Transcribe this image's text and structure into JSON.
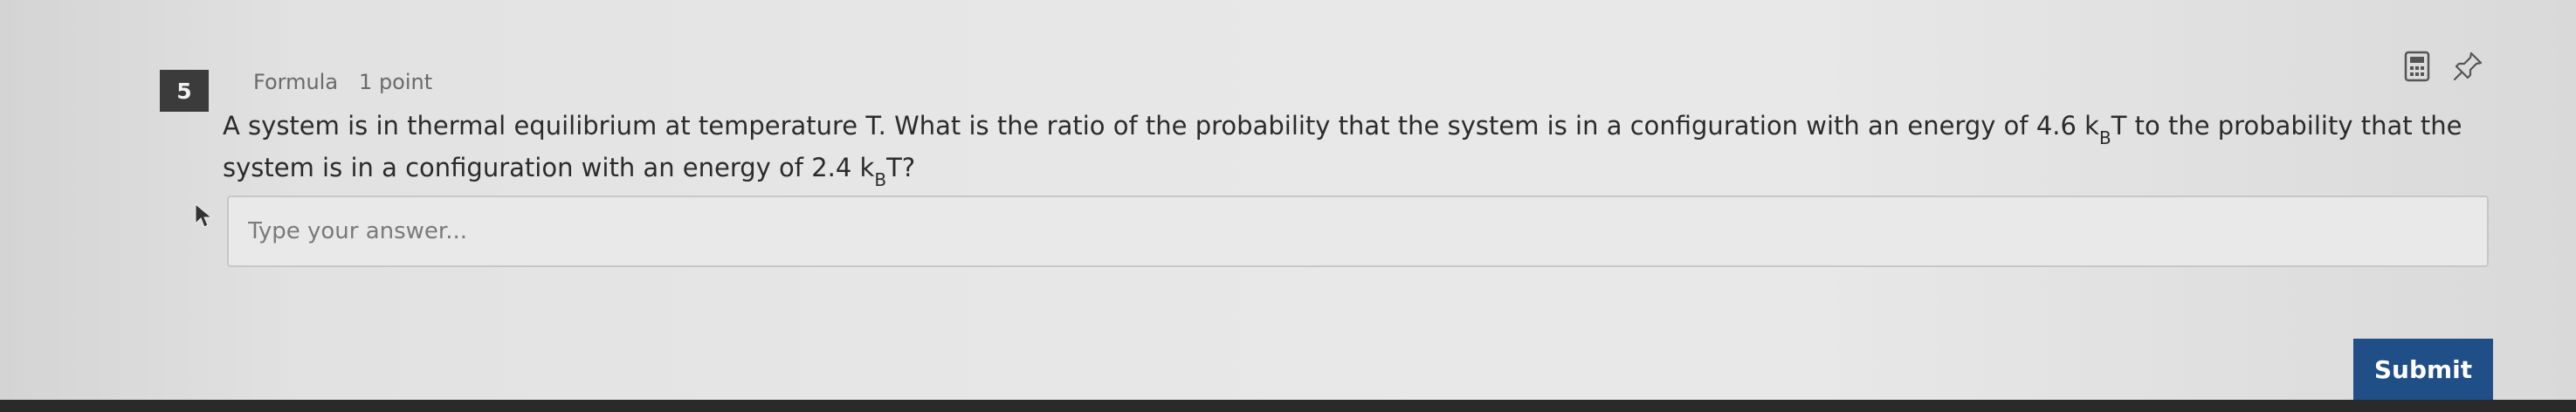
{
  "question": {
    "number": "5",
    "type_label": "Formula",
    "points_label": "1 point",
    "text_part1": "A system is in thermal equilibrium at temperature T. What is the ratio of the probability that the system is in a configuration with an energy of 4.6 k",
    "sub1": "B",
    "text_part2": "T to the probability that the system is in a configuration with an energy of 2.4 k",
    "sub2": "B",
    "text_part3": "T?"
  },
  "answer": {
    "placeholder": "Type your answer..."
  },
  "toolbar": {
    "calculator_icon": "calculator-icon",
    "pin_icon": "pin-icon"
  },
  "actions": {
    "submit_label": "Submit"
  },
  "colors": {
    "badge_bg": "#3b3b3b",
    "submit_bg": "#1f4f86",
    "page_bg": "#e5e5e5"
  }
}
